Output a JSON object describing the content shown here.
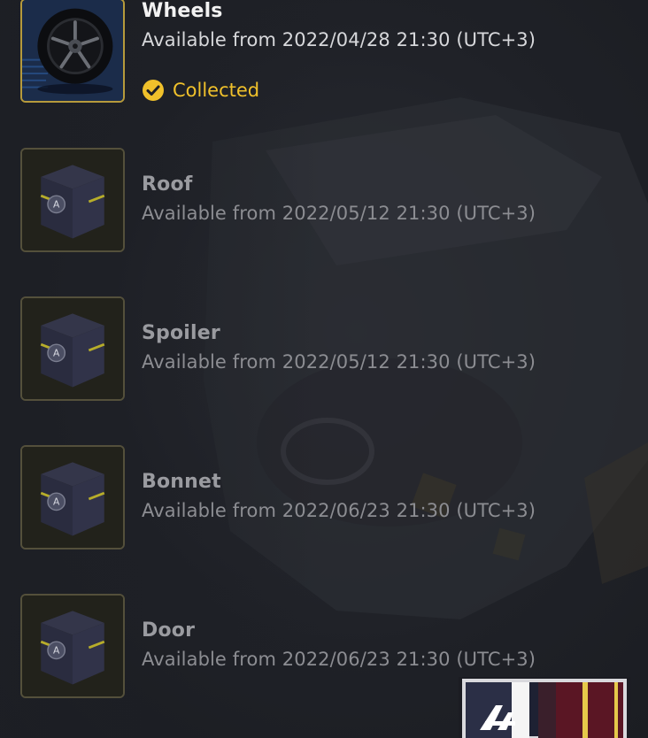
{
  "items": [
    {
      "name": "Wheels",
      "availability": "Available from 2022/04/28 21:30 (UTC+3)",
      "status": "Collected",
      "thumbnail_icon": "wheel-icon",
      "locked": false
    },
    {
      "name": "Roof",
      "availability": "Available from 2022/05/12 21:30 (UTC+3)",
      "thumbnail_icon": "mystery-box-icon",
      "locked": true
    },
    {
      "name": "Spoiler",
      "availability": "Available from 2022/05/12 21:30 (UTC+3)",
      "thumbnail_icon": "mystery-box-icon",
      "locked": true
    },
    {
      "name": "Bonnet",
      "availability": "Available from 2022/06/23 21:30 (UTC+3)",
      "thumbnail_icon": "mystery-box-icon",
      "locked": true
    },
    {
      "name": "Door",
      "availability": "Available from 2022/06/23 21:30 (UTC+3)",
      "thumbnail_icon": "mystery-box-icon",
      "locked": true
    }
  ],
  "colors": {
    "background": "#1f2127",
    "collected_accent": "#f0c12b",
    "unlocked_border": "#b69a3b",
    "locked_border": "#54503b"
  }
}
